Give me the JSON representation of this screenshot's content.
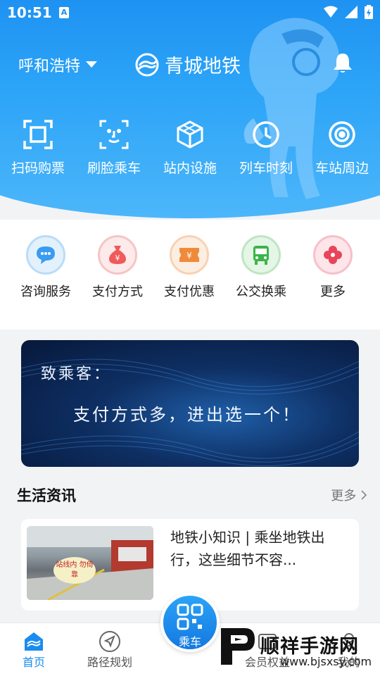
{
  "status_bar": {
    "time": "10:51",
    "notification_badge": "A"
  },
  "header": {
    "city": "呼和浩特",
    "brand": "青城地铁",
    "bg_color": "#1a8cf0"
  },
  "top_menu": [
    {
      "label": "扫码购票",
      "icon": "scan-frame-icon"
    },
    {
      "label": "刷脸乘车",
      "icon": "face-scan-icon"
    },
    {
      "label": "站内设施",
      "icon": "facility-cube-icon"
    },
    {
      "label": "列车时刻",
      "icon": "clock-icon"
    },
    {
      "label": "车站周边",
      "icon": "nearby-pin-icon"
    }
  ],
  "service_menu": [
    {
      "label": "咨询服务",
      "icon": "chat-bubble-icon",
      "color": "#3a9cf0"
    },
    {
      "label": "支付方式",
      "icon": "money-bag-icon",
      "color": "#ef5a5a"
    },
    {
      "label": "支付优惠",
      "icon": "coupon-icon",
      "color": "#f08a3a"
    },
    {
      "label": "公交换乘",
      "icon": "bus-icon",
      "color": "#3cb54a"
    },
    {
      "label": "更多",
      "icon": "more-flower-icon",
      "color": "#e8445a"
    }
  ],
  "banner": {
    "line1": "致乘客：",
    "line2": "支付方式多，进出选一个！"
  },
  "news_section": {
    "title": "生活资讯",
    "more": "更多",
    "items": [
      {
        "title": "地铁小知识 | 乘坐地铁出行，这些细节不容...",
        "thumb_badge": "站线内 勿倚靠"
      }
    ]
  },
  "bottom_nav": {
    "home": "首页",
    "route": "路径规划",
    "ride": "乘车",
    "member": "会员权益",
    "mine": "我的"
  },
  "watermark": {
    "name": "顺祥手游网",
    "url": "www.bjsxsy.com"
  }
}
